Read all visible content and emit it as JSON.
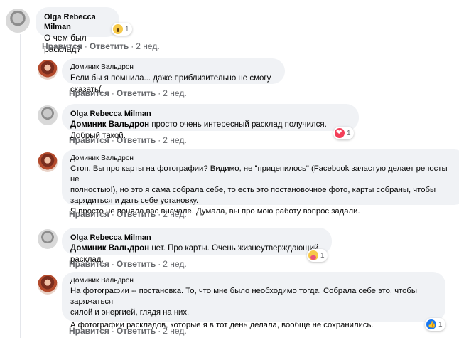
{
  "comments": [
    {
      "author": "Olga Rebecca Milman",
      "text": "О чем был расклад?",
      "like": "Нравится",
      "reply": "Ответить",
      "time": "2 нед.",
      "reaction": {
        "icon": "wow-reaction-icon",
        "count": "1"
      }
    },
    {
      "author": "Доминик Вальдрон",
      "text": "Если бы я помнила... даже приблизительно не смогу сказать(",
      "like": "Нравится",
      "reply": "Ответить",
      "time": "2 нед."
    },
    {
      "author": "Olga Rebecca Milman",
      "mention": "Доминик Вальдрон",
      "text": " просто очень интересный расклад получился. Добрый такой.",
      "like": "Нравится",
      "reply": "Ответить",
      "time": "2 нед.",
      "reaction": {
        "icon": "love-reaction-icon",
        "count": "1"
      }
    },
    {
      "author": "Доминик Вальдрон",
      "text_lines": [
        "Стоп. Вы про карты на фотографии? Видимо, не \"прицепилось\" (Facebook зачастую делает репосты не",
        "полностью!), но это я сама собрала себе, то есть это постановочное фото, карты собраны, чтобы",
        "зарядиться и дать себе установку.",
        "Я просто не поняла вас вначале. Думала, вы про мою работу вопрос задали."
      ],
      "like": "Нравится",
      "reply": "Ответить",
      "time": "2 нед."
    },
    {
      "author": "Olga Rebecca Milman",
      "mention": "Доминик Вальдрон",
      "text": " нет. Про карты. Очень жизнеутверждающий расклад.",
      "like": "Нравится",
      "reply": "Ответить",
      "time": "2 нед.",
      "reaction": {
        "icon": "care-reaction-icon",
        "count": "1"
      }
    },
    {
      "author": "Доминик Вальдрон",
      "text_lines": [
        "На фотографии -- постановка. То, что мне было необходимо тогда. Собрала себе это, чтобы заряжаться",
        "силой и энергией, глядя на них.",
        "А фотографии раскладов, которые я в тот день делала, вообще не сохранились."
      ],
      "like": "Нравится",
      "reply": "Ответить",
      "time": "2 нед.",
      "reaction": {
        "icon": "like-reaction-icon",
        "count": "1"
      }
    }
  ],
  "colors": {
    "bubble": "#f0f2f5",
    "meta": "#65676b",
    "like": "#1877f2",
    "love": "#f33e58"
  }
}
